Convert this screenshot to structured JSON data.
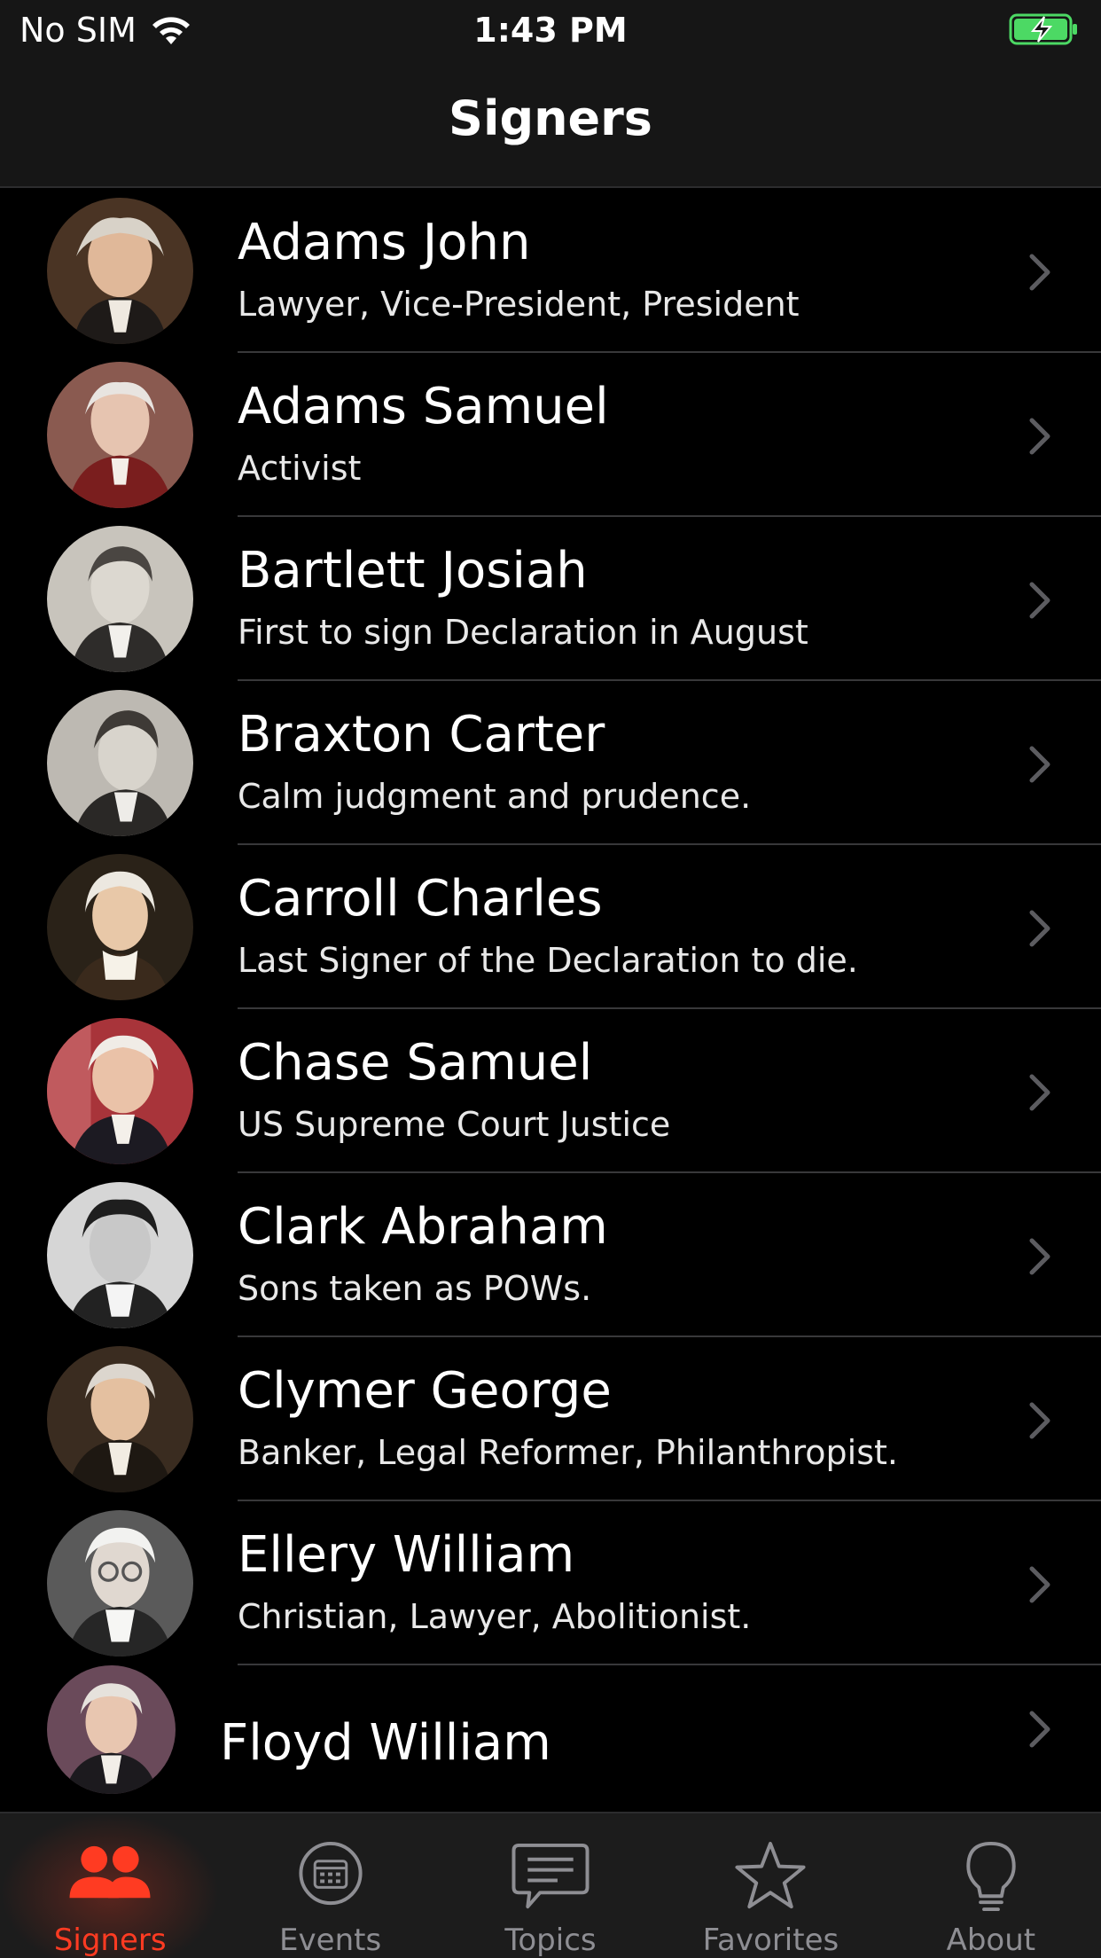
{
  "status_bar": {
    "carrier": "No SIM",
    "time": "1:43 PM"
  },
  "nav": {
    "title": "Signers"
  },
  "signers": [
    {
      "name": "Adams John",
      "subtitle": "Lawyer, Vice-President, President"
    },
    {
      "name": "Adams Samuel",
      "subtitle": "Activist"
    },
    {
      "name": "Bartlett Josiah",
      "subtitle": "First to sign Declaration in August"
    },
    {
      "name": "Braxton Carter",
      "subtitle": "Calm judgment and prudence."
    },
    {
      "name": "Carroll Charles",
      "subtitle": "Last Signer of the Declaration to die."
    },
    {
      "name": "Chase Samuel",
      "subtitle": "US Supreme Court Justice"
    },
    {
      "name": "Clark Abraham",
      "subtitle": "Sons taken as POWs."
    },
    {
      "name": "Clymer George",
      "subtitle": "Banker, Legal Reformer, Philanthropist."
    },
    {
      "name": "Ellery William",
      "subtitle": "Christian, Lawyer, Abolitionist."
    },
    {
      "name": "Floyd William",
      "subtitle": ""
    }
  ],
  "tabs": [
    {
      "label": "Signers",
      "icon": "people-icon",
      "active": true
    },
    {
      "label": "Events",
      "icon": "calendar-icon"
    },
    {
      "label": "Topics",
      "icon": "chat-bubble-icon"
    },
    {
      "label": "Favorites",
      "icon": "star-icon"
    },
    {
      "label": "About",
      "icon": "lightbulb-icon"
    }
  ],
  "colors": {
    "accent": "#ff3b22",
    "inactive": "#8e8e93",
    "battery": "#4cd964"
  }
}
